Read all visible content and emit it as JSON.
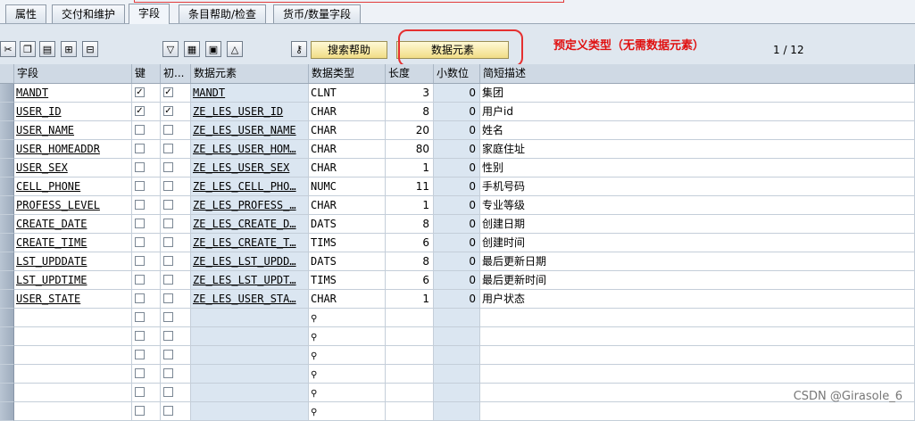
{
  "tabs": [
    "属性",
    "交付和维护",
    "字段",
    "条目帮助/检查",
    "货币/数量字段"
  ],
  "active_tab": "字段",
  "toolbar": {
    "search_help_label": "搜索帮助",
    "data_element_label": "数据元素"
  },
  "annotation": "预定义类型（无需数据元素）",
  "pager": "1  /  12",
  "columns": [
    "字段",
    "键",
    "初...",
    "数据元素",
    "数据类型",
    "长度",
    "小数位",
    "简短描述"
  ],
  "rows": [
    {
      "field": "MANDT",
      "key": true,
      "init": true,
      "element": "MANDT",
      "type": "CLNT",
      "len": "3",
      "dec": "0",
      "desc": "集团"
    },
    {
      "field": "USER_ID",
      "key": true,
      "init": true,
      "element": "ZE_LES_USER_ID",
      "type": "CHAR",
      "len": "8",
      "dec": "0",
      "desc": "用户id"
    },
    {
      "field": "USER_NAME",
      "key": false,
      "init": false,
      "element": "ZE_LES_USER_NAME",
      "type": "CHAR",
      "len": "20",
      "dec": "0",
      "desc": "姓名"
    },
    {
      "field": "USER_HOMEADDR",
      "key": false,
      "init": false,
      "element": "ZE_LES_USER_HOM…",
      "type": "CHAR",
      "len": "80",
      "dec": "0",
      "desc": "家庭住址"
    },
    {
      "field": "USER_SEX",
      "key": false,
      "init": false,
      "element": "ZE_LES_USER_SEX",
      "type": "CHAR",
      "len": "1",
      "dec": "0",
      "desc": "性别"
    },
    {
      "field": "CELL_PHONE",
      "key": false,
      "init": false,
      "element": "ZE_LES_CELL_PHO…",
      "type": "NUMC",
      "len": "11",
      "dec": "0",
      "desc": "手机号码"
    },
    {
      "field": "PROFESS_LEVEL",
      "key": false,
      "init": false,
      "element": "ZE_LES_PROFESS_…",
      "type": "CHAR",
      "len": "1",
      "dec": "0",
      "desc": "专业等级"
    },
    {
      "field": "CREATE_DATE",
      "key": false,
      "init": false,
      "element": "ZE_LES_CREATE_D…",
      "type": "DATS",
      "len": "8",
      "dec": "0",
      "desc": "创建日期"
    },
    {
      "field": "CREATE_TIME",
      "key": false,
      "init": false,
      "element": "ZE_LES_CREATE_T…",
      "type": "TIMS",
      "len": "6",
      "dec": "0",
      "desc": "创建时间"
    },
    {
      "field": "LST_UPDDATE",
      "key": false,
      "init": false,
      "element": "ZE_LES_LST_UPDD…",
      "type": "DATS",
      "len": "8",
      "dec": "0",
      "desc": "最后更新日期"
    },
    {
      "field": "LST_UPDTIME",
      "key": false,
      "init": false,
      "element": "ZE_LES_LST_UPDT…",
      "type": "TIMS",
      "len": "6",
      "dec": "0",
      "desc": "最后更新时间"
    },
    {
      "field": "USER_STATE",
      "key": false,
      "init": false,
      "element": "ZE_LES_USER_STA…",
      "type": "CHAR",
      "len": "1",
      "dec": "0",
      "desc": "用户状态"
    }
  ],
  "empty_rows": 6,
  "watermark": "CSDN @Girasole_6"
}
